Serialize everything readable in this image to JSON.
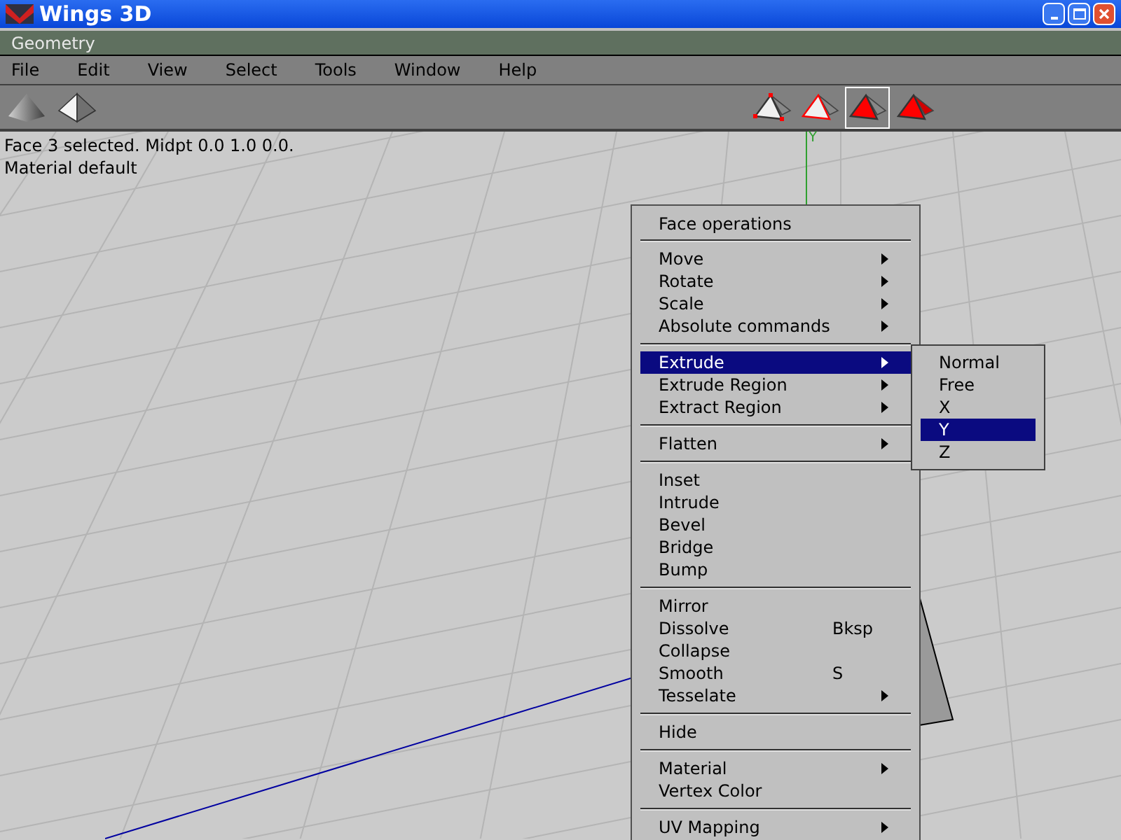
{
  "window": {
    "title": "Wings 3D"
  },
  "geometry_bar": {
    "title": "Geometry"
  },
  "menu_bar": [
    "File",
    "Edit",
    "View",
    "Select",
    "Tools",
    "Window",
    "Help"
  ],
  "view_buttons": [
    {
      "kind": "smooth"
    },
    {
      "kind": "flat"
    }
  ],
  "selection_modes": [
    {
      "kind": "vertex",
      "selected": false
    },
    {
      "kind": "edge",
      "selected": false
    },
    {
      "kind": "face",
      "selected": true
    },
    {
      "kind": "body",
      "selected": false
    }
  ],
  "status": [
    "Face 3 selected. Midpt 0.0 1.0 0.0.",
    "Material default"
  ],
  "axis_label": "Y",
  "context_menu": {
    "title": "Face operations",
    "groups": [
      [
        {
          "label": "Move",
          "submenu": true,
          "selected": false
        },
        {
          "label": "Rotate",
          "submenu": true,
          "selected": false
        },
        {
          "label": "Scale",
          "submenu": true,
          "selected": false
        },
        {
          "label": "Absolute commands",
          "submenu": true,
          "selected": false
        }
      ],
      [
        {
          "label": "Extrude",
          "submenu": true,
          "selected": true
        },
        {
          "label": "Extrude Region",
          "submenu": true,
          "selected": false
        },
        {
          "label": "Extract Region",
          "submenu": true,
          "selected": false
        }
      ],
      [
        {
          "label": "Flatten",
          "submenu": true,
          "selected": false
        }
      ],
      [
        {
          "label": "Inset",
          "submenu": false,
          "selected": false
        },
        {
          "label": "Intrude",
          "submenu": false,
          "selected": false
        },
        {
          "label": "Bevel",
          "submenu": false,
          "selected": false
        },
        {
          "label": "Bridge",
          "submenu": false,
          "selected": false
        },
        {
          "label": "Bump",
          "submenu": false,
          "selected": false
        }
      ],
      [
        {
          "label": "Mirror",
          "submenu": false,
          "selected": false
        },
        {
          "label": "Dissolve",
          "shortcut": "Bksp",
          "submenu": false,
          "selected": false
        },
        {
          "label": "Collapse",
          "submenu": false,
          "selected": false
        },
        {
          "label": "Smooth",
          "shortcut": "S",
          "submenu": false,
          "selected": false
        },
        {
          "label": "Tesselate",
          "submenu": true,
          "selected": false
        }
      ],
      [
        {
          "label": "Hide",
          "submenu": false,
          "selected": false
        }
      ],
      [
        {
          "label": "Material",
          "submenu": true,
          "selected": false
        },
        {
          "label": "Vertex Color",
          "submenu": false,
          "selected": false
        }
      ],
      [
        {
          "label": "UV Mapping",
          "submenu": true,
          "selected": false
        }
      ]
    ]
  },
  "submenu": [
    {
      "label": "Normal",
      "selected": false
    },
    {
      "label": "Free",
      "selected": false
    },
    {
      "label": "X",
      "selected": false
    },
    {
      "label": "Y",
      "selected": true
    },
    {
      "label": "Z",
      "selected": false
    }
  ]
}
